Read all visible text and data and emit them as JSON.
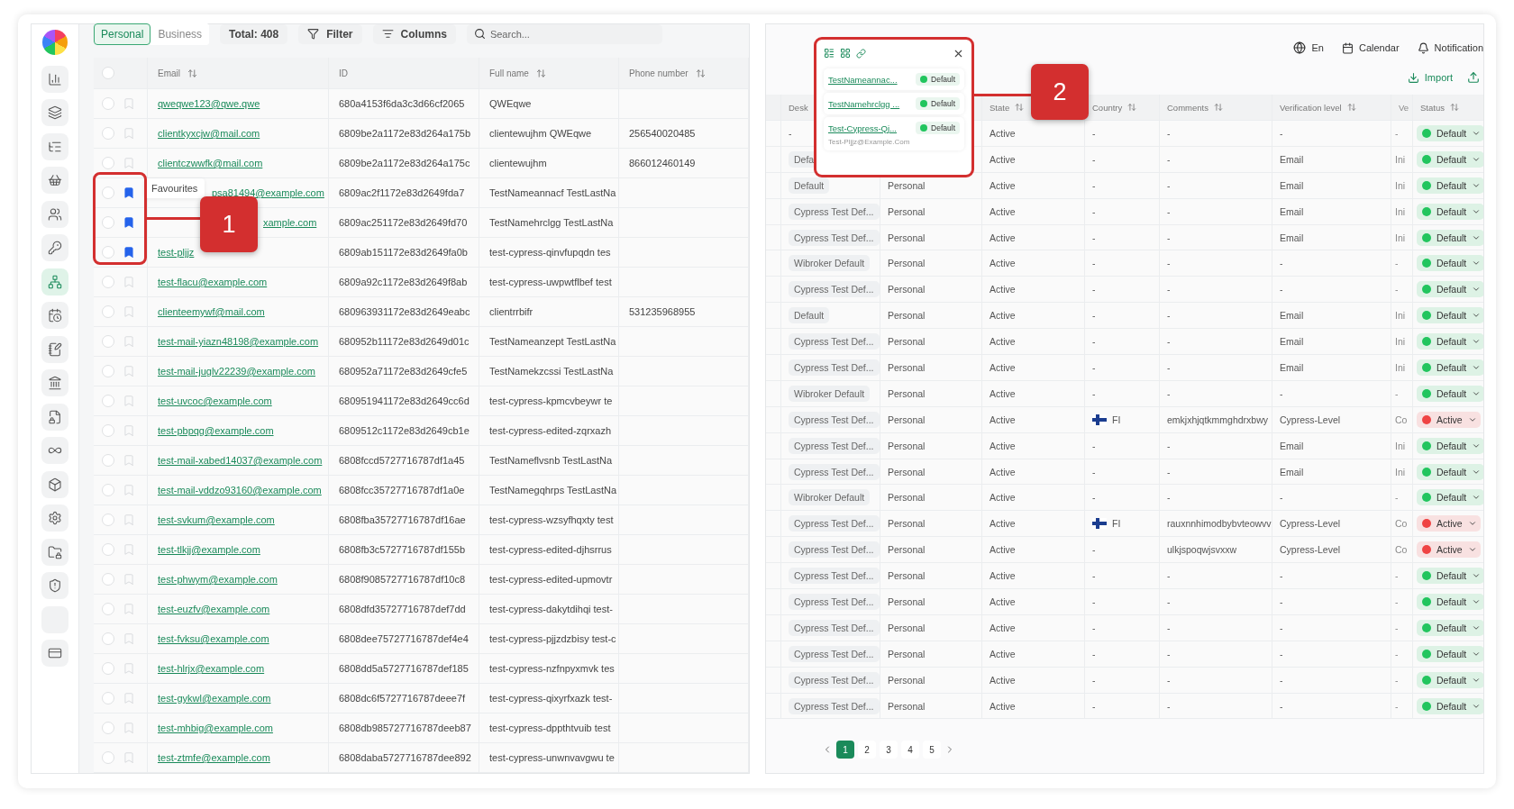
{
  "sidebar": {
    "items": [
      {
        "kind": "icon",
        "selected": false
      },
      {
        "kind": "icon",
        "selected": false
      },
      {
        "kind": "icon",
        "selected": false
      },
      {
        "kind": "icon",
        "selected": false
      },
      {
        "kind": "icon",
        "selected": false
      },
      {
        "kind": "icon",
        "selected": false
      },
      {
        "kind": "icon",
        "selected": true
      },
      {
        "kind": "icon",
        "selected": false
      },
      {
        "kind": "icon",
        "selected": false
      },
      {
        "kind": "icon",
        "selected": false
      },
      {
        "kind": "icon",
        "selected": false
      },
      {
        "kind": "icon",
        "selected": false
      },
      {
        "kind": "icon",
        "selected": false
      },
      {
        "kind": "icon",
        "selected": false
      },
      {
        "kind": "icon",
        "selected": false
      },
      {
        "kind": "icon",
        "selected": false
      },
      {
        "kind": "blank",
        "selected": false
      },
      {
        "kind": "icon",
        "selected": false
      }
    ]
  },
  "toolbar": {
    "tabs": [
      {
        "label": "Personal",
        "selected": true
      },
      {
        "label": "Business",
        "selected": false
      }
    ],
    "total": "Total: 408",
    "filter": "Filter",
    "columns": "Columns",
    "search": {
      "placeholder": "Search..."
    }
  },
  "left_table": {
    "header_checked": false,
    "columns": [
      {
        "label": "Email",
        "sortable": true
      },
      {
        "label": "ID",
        "sortable": false
      },
      {
        "label": "Full name",
        "sortable": true
      },
      {
        "label": "Phone number",
        "sortable": true
      }
    ],
    "rows": [
      {
        "checked": false,
        "favourite": false,
        "email": "qweqwe123@qwe.qwe",
        "id": "680a4153f6da3c3d66cf2065",
        "full_name": "QWEqwe"
      },
      {
        "checked": false,
        "favourite": false,
        "email": "clientkyxcjw@mail.com",
        "id": "6809be2a1172e83d264a175b",
        "full_name": "clientewujhm QWEqwe",
        "phone": "256540020485"
      },
      {
        "checked": false,
        "favourite": false,
        "email": "clientczwwfk@mail.com",
        "id": "6809be2a1172e83d264a175c",
        "full_name": "clientewujhm",
        "phone": "866012460149"
      },
      {
        "checked": false,
        "favourite": true,
        "email": "psa81494@example.com",
        "id": "6809ac2f1172e83d2649fda7",
        "full_name": "TestNameannacf TestLastNa"
      },
      {
        "checked": false,
        "favourite": true,
        "email": "xample.com",
        "id": "6809ac251172e83d2649fd70",
        "full_name": "TestNamehrclgg TestLastNa"
      },
      {
        "checked": false,
        "favourite": true,
        "email": "test-pljjz",
        "id": "6809ab151172e83d2649fa0b",
        "full_name": "test-cypress-qinvfupqdn tes"
      },
      {
        "checked": false,
        "favourite": false,
        "email": "test-flacu@example.com",
        "id": "6809a92c1172e83d2649f8ab",
        "full_name": "test-cypress-uwpwtflbef test"
      },
      {
        "checked": false,
        "favourite": false,
        "email": "clienteemywf@mail.com",
        "id": "680963931172e83d2649eabc",
        "full_name": "clientrrbifr",
        "phone": "531235968955"
      },
      {
        "checked": false,
        "favourite": false,
        "email": "test-mail-yiazn48198@example.com",
        "id": "680952b11172e83d2649d01c",
        "full_name": "TestNameanzept TestLastNa"
      },
      {
        "checked": false,
        "favourite": false,
        "email": "test-mail-juglv22239@example.com",
        "id": "680952a71172e83d2649cfe5",
        "full_name": "TestNamekzcssi TestLastNa"
      },
      {
        "checked": false,
        "favourite": false,
        "email": "test-uvcoc@example.com",
        "id": "680951941172e83d2649cc6d",
        "full_name": "test-cypress-kpmcvbeywr te"
      },
      {
        "checked": false,
        "favourite": false,
        "email": "test-pbpqg@example.com",
        "id": "6809512c1172e83d2649cb1e",
        "full_name": "test-cypress-edited-zqrxazh"
      },
      {
        "checked": false,
        "favourite": false,
        "email": "test-mail-xabed14037@example.com",
        "id": "6808fccd5727716787df1a45",
        "full_name": "TestNameflvsnb TestLastNa"
      },
      {
        "checked": false,
        "favourite": false,
        "email": "test-mail-vddzo93160@example.com",
        "id": "6808fcc35727716787df1a0e",
        "full_name": "TestNamegqhrps TestLastNa"
      },
      {
        "checked": false,
        "favourite": false,
        "email": "test-svkum@example.com",
        "id": "6808fba35727716787df16ae",
        "full_name": "test-cypress-wzsyfhqxty test"
      },
      {
        "checked": false,
        "favourite": false,
        "email": "test-tlkjj@example.com",
        "id": "6808fb3c5727716787df155b",
        "full_name": "test-cypress-edited-djhsrrus"
      },
      {
        "checked": false,
        "favourite": false,
        "email": "test-phwym@example.com",
        "id": "6808f9085727716787df10c8",
        "full_name": "test-cypress-edited-upmovtr"
      },
      {
        "checked": false,
        "favourite": false,
        "email": "test-euzfv@example.com",
        "id": "6808dfd35727716787def7dd",
        "full_name": "test-cypress-dakytdihqi test-"
      },
      {
        "checked": false,
        "favourite": false,
        "email": "test-fvksu@example.com",
        "id": "6808dee75727716787def4e4",
        "full_name": "test-cypress-pjjzdzbisy test-c"
      },
      {
        "checked": false,
        "favourite": false,
        "email": "test-hlrjx@example.com",
        "id": "6808dd5a5727716787def185",
        "full_name": "test-cypress-nzfnpyxmvk tes"
      },
      {
        "checked": false,
        "favourite": false,
        "email": "test-gykwl@example.com",
        "id": "6808dc6f5727716787deee7f",
        "full_name": "test-cypress-qixyrfxazk test-"
      },
      {
        "checked": false,
        "favourite": false,
        "email": "test-mhbig@example.com",
        "id": "6808db985727716787deeb87",
        "full_name": "test-cypress-dppthtvuib test"
      },
      {
        "checked": false,
        "favourite": false,
        "email": "test-ztmfe@example.com",
        "id": "6808daba5727716787dee892",
        "full_name": "test-cypress-unwnvavgwu te"
      }
    ]
  },
  "tooltip": "Favourites",
  "annotations": [
    {
      "label": "1"
    },
    {
      "label": "2"
    }
  ],
  "topbar": {
    "language": "En",
    "calendar": "Calendar",
    "notification": "Notification",
    "import": "Import"
  },
  "popover": {
    "items": [
      {
        "name": "TestNameannac...",
        "status": "Default",
        "color": "#22c55e"
      },
      {
        "name": "TestNamehrclgg ...",
        "status": "Default",
        "color": "#22c55e"
      },
      {
        "name": "Test-Cypress-Qj...",
        "status": "Default",
        "color": "#22c55e",
        "email": "Test-Pljjz@Example.Com"
      }
    ]
  },
  "right_table": {
    "columns": [
      {
        "label": "Desk"
      },
      {
        "label": "State",
        "sortable": true
      },
      {
        "label": "Country",
        "sortable": true
      },
      {
        "label": "Comments",
        "sortable": true
      },
      {
        "label": "Verification level",
        "sortable": true
      },
      {
        "label": "Ve"
      },
      {
        "label": "Status",
        "sortable": true
      }
    ],
    "rows": [
      {
        "desk": {
          "text": "-",
          "kind": "plain"
        },
        "state": "Active",
        "country": {
          "text": "-",
          "kind": "plain"
        },
        "comments": "-",
        "verification": "-",
        "column_7": "-",
        "status": {
          "text": "Default",
          "color": "#22c55e"
        }
      },
      {
        "desk": {
          "text": "Defa",
          "kind": "chip"
        },
        "state": "Active",
        "country": {
          "text": "-",
          "kind": "plain"
        },
        "comments": "-",
        "verification": "Email",
        "column_7": "Ini",
        "status": {
          "text": "Default",
          "color": "#22c55e"
        }
      },
      {
        "desk": {
          "text": "Default",
          "kind": "chip"
        },
        "type": "Personal",
        "state": "Active",
        "country": {
          "text": "-",
          "kind": "plain"
        },
        "comments": "-",
        "verification": "Email",
        "column_7": "Ini",
        "status": {
          "text": "Default",
          "color": "#22c55e"
        }
      },
      {
        "desk": {
          "text": "Cypress Test Def...",
          "kind": "chip"
        },
        "type": "Personal",
        "state": "Active",
        "country": {
          "text": "-",
          "kind": "plain"
        },
        "comments": "-",
        "verification": "Email",
        "column_7": "Ini",
        "status": {
          "text": "Default",
          "color": "#22c55e"
        }
      },
      {
        "desk": {
          "text": "Cypress Test Def...",
          "kind": "chip"
        },
        "type": "Personal",
        "state": "Active",
        "country": {
          "text": "-",
          "kind": "plain"
        },
        "comments": "-",
        "verification": "Email",
        "column_7": "Ini",
        "status": {
          "text": "Default",
          "color": "#22c55e"
        }
      },
      {
        "desk": {
          "text": "Wibroker Default",
          "kind": "chip"
        },
        "type": "Personal",
        "state": "Active",
        "country": {
          "text": "-",
          "kind": "plain"
        },
        "comments": "-",
        "verification": "-",
        "column_7": "-",
        "status": {
          "text": "Default",
          "color": "#22c55e"
        }
      },
      {
        "desk": {
          "text": "Cypress Test Def...",
          "kind": "chip"
        },
        "type": "Personal",
        "state": "Active",
        "country": {
          "text": "-",
          "kind": "plain"
        },
        "comments": "-",
        "verification": "-",
        "column_7": "-",
        "status": {
          "text": "Default",
          "color": "#22c55e"
        }
      },
      {
        "desk": {
          "text": "Default",
          "kind": "chip"
        },
        "type": "Personal",
        "state": "Active",
        "country": {
          "text": "-",
          "kind": "plain"
        },
        "comments": "-",
        "verification": "Email",
        "column_7": "Ini",
        "status": {
          "text": "Default",
          "color": "#22c55e"
        }
      },
      {
        "desk": {
          "text": "Cypress Test Def...",
          "kind": "chip"
        },
        "type": "Personal",
        "state": "Active",
        "country": {
          "text": "-",
          "kind": "plain"
        },
        "comments": "-",
        "verification": "Email",
        "column_7": "Ini",
        "status": {
          "text": "Default",
          "color": "#22c55e"
        }
      },
      {
        "desk": {
          "text": "Cypress Test Def...",
          "kind": "chip"
        },
        "type": "Personal",
        "state": "Active",
        "country": {
          "text": "-",
          "kind": "plain"
        },
        "comments": "-",
        "verification": "Email",
        "column_7": "Ini",
        "status": {
          "text": "Default",
          "color": "#22c55e"
        }
      },
      {
        "desk": {
          "text": "Wibroker Default",
          "kind": "chip"
        },
        "type": "Personal",
        "state": "Active",
        "country": {
          "text": "-",
          "kind": "plain"
        },
        "comments": "-",
        "verification": "-",
        "column_7": "-",
        "status": {
          "text": "Default",
          "color": "#22c55e"
        }
      },
      {
        "desk": {
          "text": "Cypress Test Def...",
          "kind": "chip"
        },
        "type": "Personal",
        "state": "Active",
        "country": {
          "text": "FI",
          "kind": "flag"
        },
        "comments": "emkjxhjqtkmmghdrxbwy",
        "verification": "Cypress-Level",
        "column_7": "Co",
        "status": {
          "text": "Active",
          "color": "#ef4444"
        }
      },
      {
        "desk": {
          "text": "Cypress Test Def...",
          "kind": "chip"
        },
        "type": "Personal",
        "state": "Active",
        "country": {
          "text": "-",
          "kind": "plain"
        },
        "comments": "-",
        "verification": "Email",
        "column_7": "Ini",
        "status": {
          "text": "Default",
          "color": "#22c55e"
        }
      },
      {
        "desk": {
          "text": "Cypress Test Def...",
          "kind": "chip"
        },
        "type": "Personal",
        "state": "Active",
        "country": {
          "text": "-",
          "kind": "plain"
        },
        "comments": "-",
        "verification": "Email",
        "column_7": "Ini",
        "status": {
          "text": "Default",
          "color": "#22c55e"
        }
      },
      {
        "desk": {
          "text": "Wibroker Default",
          "kind": "chip"
        },
        "type": "Personal",
        "state": "Active",
        "country": {
          "text": "-",
          "kind": "plain"
        },
        "comments": "-",
        "verification": "-",
        "column_7": "-",
        "status": {
          "text": "Default",
          "color": "#22c55e"
        }
      },
      {
        "desk": {
          "text": "Cypress Test Def...",
          "kind": "chip"
        },
        "type": "Personal",
        "state": "Active",
        "country": {
          "text": "FI",
          "kind": "flag"
        },
        "comments": "rauxnnhimodbybvteowvv",
        "verification": "Cypress-Level",
        "column_7": "Co",
        "status": {
          "text": "Active",
          "color": "#ef4444"
        }
      },
      {
        "desk": {
          "text": "Cypress Test Def...",
          "kind": "chip"
        },
        "type": "Personal",
        "state": "Active",
        "country": {
          "text": "-",
          "kind": "plain"
        },
        "comments": "ulkjspoqwjsvxxw",
        "verification": "Cypress-Level",
        "column_7": "Co",
        "status": {
          "text": "Active",
          "color": "#ef4444"
        }
      },
      {
        "desk": {
          "text": "Cypress Test Def...",
          "kind": "chip"
        },
        "type": "Personal",
        "state": "Active",
        "country": {
          "text": "-",
          "kind": "plain"
        },
        "comments": "-",
        "verification": "-",
        "column_7": "-",
        "status": {
          "text": "Default",
          "color": "#22c55e"
        }
      },
      {
        "desk": {
          "text": "Cypress Test Def...",
          "kind": "chip"
        },
        "type": "Personal",
        "state": "Active",
        "country": {
          "text": "-",
          "kind": "plain"
        },
        "comments": "-",
        "verification": "-",
        "column_7": "-",
        "status": {
          "text": "Default",
          "color": "#22c55e"
        }
      },
      {
        "desk": {
          "text": "Cypress Test Def...",
          "kind": "chip"
        },
        "type": "Personal",
        "state": "Active",
        "country": {
          "text": "-",
          "kind": "plain"
        },
        "comments": "-",
        "verification": "-",
        "column_7": "-",
        "status": {
          "text": "Default",
          "color": "#22c55e"
        }
      },
      {
        "desk": {
          "text": "Cypress Test Def...",
          "kind": "chip"
        },
        "type": "Personal",
        "state": "Active",
        "country": {
          "text": "-",
          "kind": "plain"
        },
        "comments": "-",
        "verification": "-",
        "column_7": "-",
        "status": {
          "text": "Default",
          "color": "#22c55e"
        }
      },
      {
        "desk": {
          "text": "Cypress Test Def...",
          "kind": "chip"
        },
        "type": "Personal",
        "state": "Active",
        "country": {
          "text": "-",
          "kind": "plain"
        },
        "comments": "-",
        "verification": "-",
        "column_7": "-",
        "status": {
          "text": "Default",
          "color": "#22c55e"
        }
      },
      {
        "desk": {
          "text": "Cypress Test Def...",
          "kind": "chip"
        },
        "type": "Personal",
        "state": "Active",
        "country": {
          "text": "-",
          "kind": "plain"
        },
        "comments": "-",
        "verification": "-",
        "column_7": "-",
        "status": {
          "text": "Default",
          "color": "#22c55e"
        }
      }
    ]
  },
  "pagination": {
    "pages": [
      {
        "label": "1",
        "selected": true
      },
      {
        "label": "2",
        "selected": false
      },
      {
        "label": "3",
        "selected": false
      },
      {
        "label": "4",
        "selected": false
      },
      {
        "label": "5",
        "selected": false
      }
    ]
  }
}
